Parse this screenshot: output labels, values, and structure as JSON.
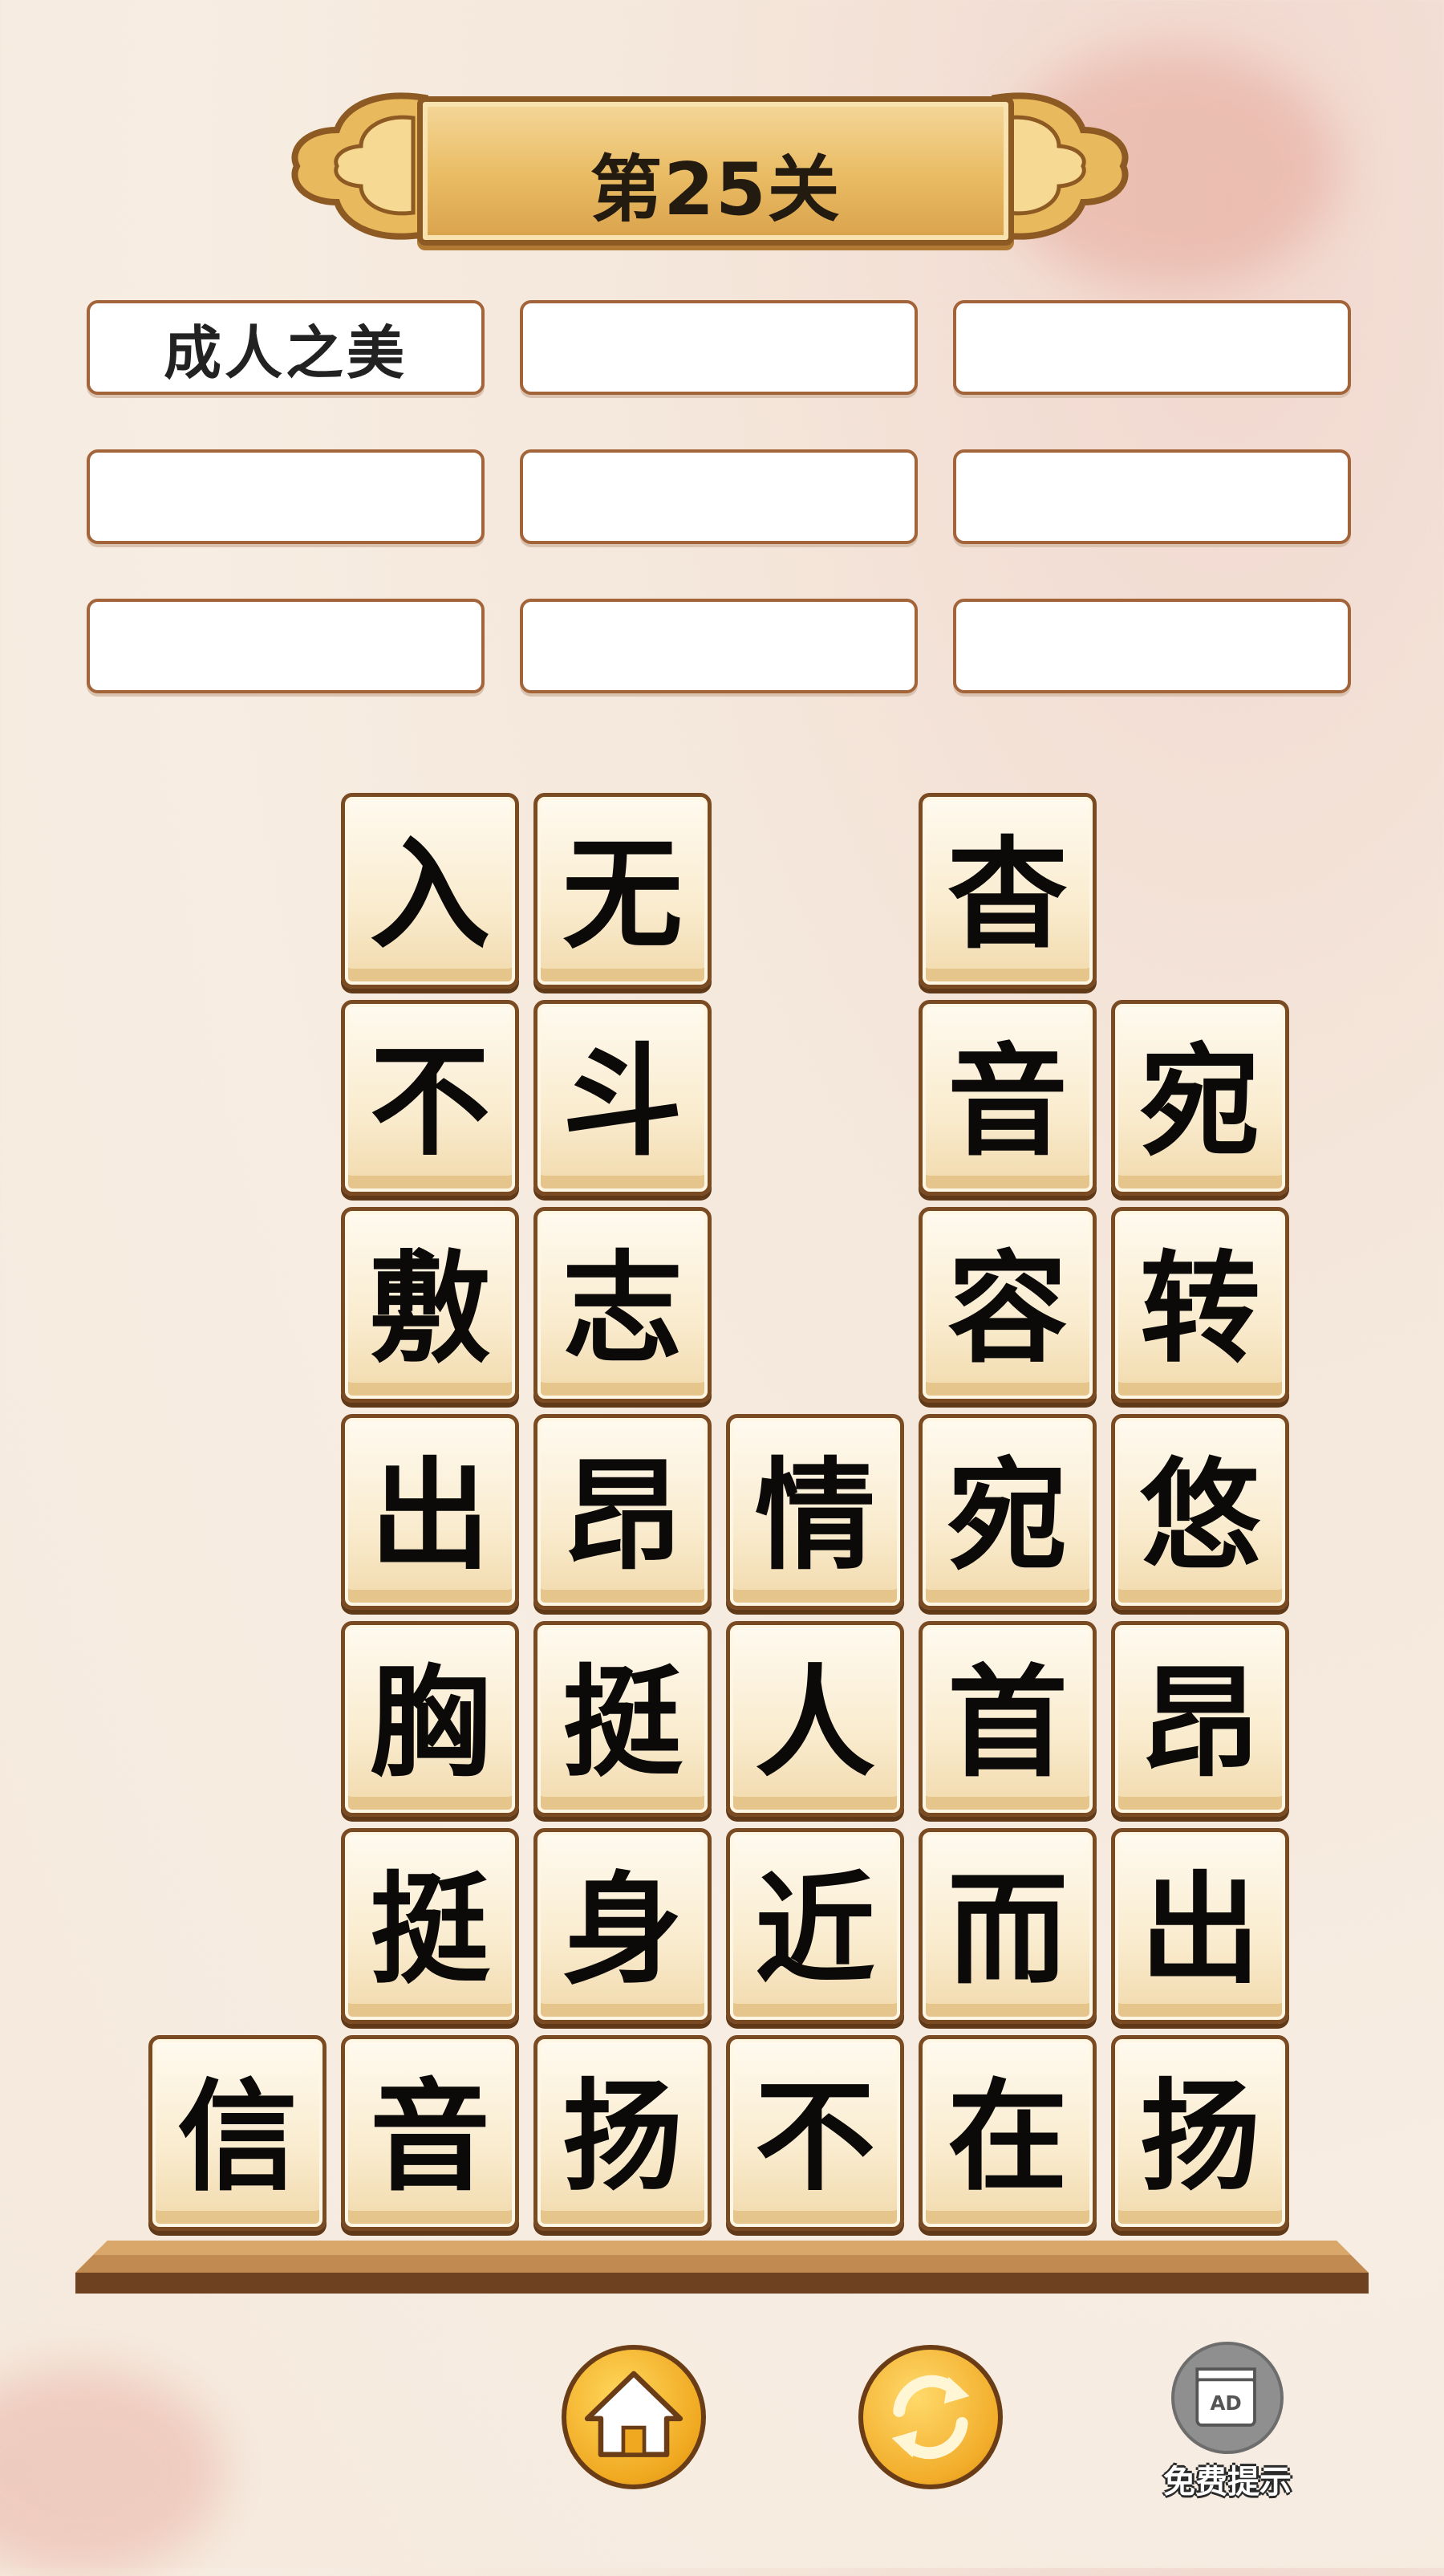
{
  "level": {
    "title": "第25关"
  },
  "answers": [
    "成人之美",
    "",
    "",
    "",
    "",
    "",
    "",
    "",
    ""
  ],
  "tiles": {
    "row1": [
      "入",
      "无",
      "杳"
    ],
    "row2": [
      "不",
      "斗",
      "音",
      "宛"
    ],
    "row3": [
      "敷",
      "志",
      "容",
      "转"
    ],
    "row4": [
      "出",
      "昂",
      "情",
      "宛",
      "悠"
    ],
    "row5": [
      "胸",
      "挺",
      "人",
      "首",
      "昂"
    ],
    "row6": [
      "挺",
      "身",
      "近",
      "而",
      "出"
    ],
    "row7": [
      "信",
      "音",
      "扬",
      "不",
      "在",
      "扬"
    ]
  },
  "buttons": {
    "home_icon": "home-icon",
    "refresh_icon": "refresh-icon",
    "ad_badge": "AD",
    "ad_label": "免费提示"
  },
  "colors": {
    "tile_border": "#7a4a22",
    "slot_border": "#a3643a",
    "button_gold": "#f0a820",
    "background": "#f7ede2"
  }
}
